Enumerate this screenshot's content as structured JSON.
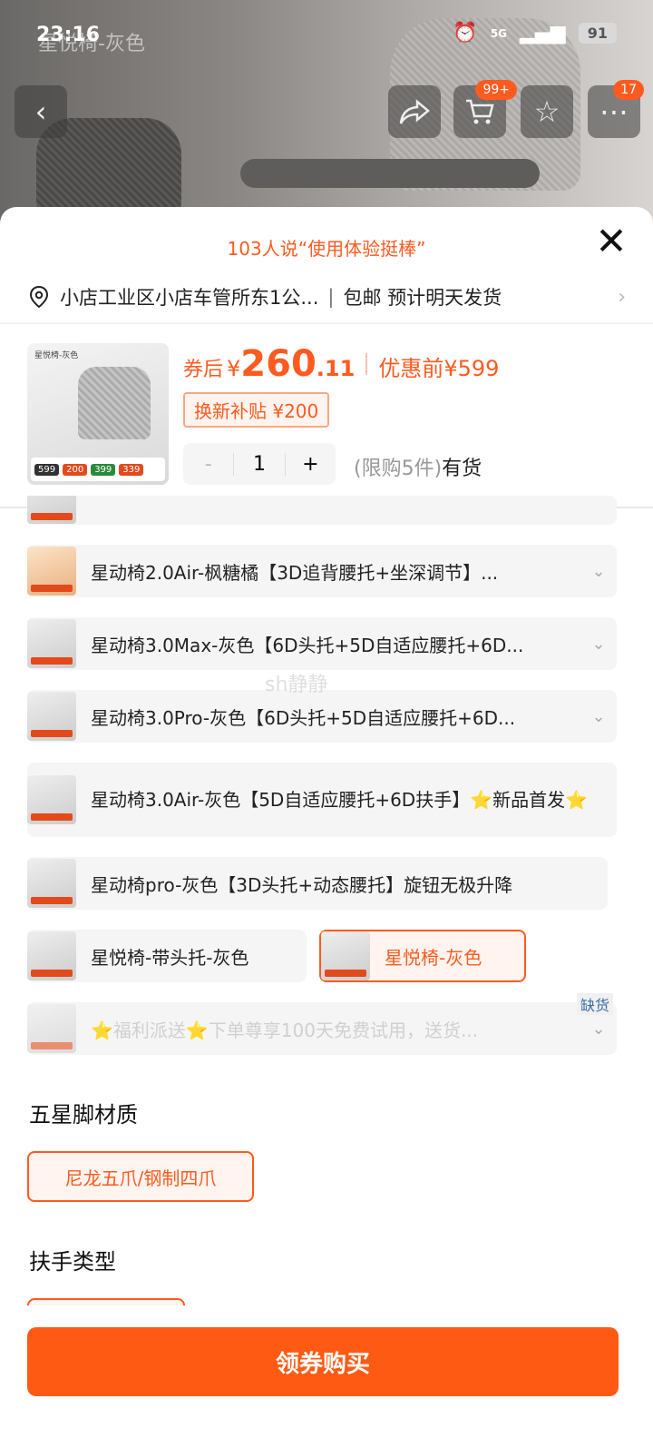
{
  "status": {
    "time": "23:16",
    "network": "5G",
    "battery": "91"
  },
  "page": {
    "title": "星悦椅-灰色"
  },
  "header": {
    "cart_badge": "99+",
    "menu_badge": "17"
  },
  "sheet": {
    "reviews_tip": "103人说“使用体验挺棒”",
    "address": "小店工业区小店车管所东1公...",
    "shipping": "包邮 预计明天发货",
    "price": {
      "coupon_label": "券后",
      "currency": "¥",
      "integer": "260",
      "decimal": ".11",
      "original_label": "优惠前",
      "original": "¥599"
    },
    "subsidy": "换新补贴 ¥200",
    "quantity": {
      "minus": "-",
      "value": "1",
      "plus": "+"
    },
    "limit": "(限购5件)",
    "stock": "有货",
    "thumb": {
      "label": "星悦椅-灰色",
      "tags": [
        "599",
        "200",
        "399",
        "339"
      ]
    }
  },
  "options": [
    {
      "text": "星动椅2.0Air-枫糖橘【3D追背腰托+坐深调节】...",
      "expandable": true
    },
    {
      "text": "星动椅3.0Max-灰色【6D头托+5D自适应腰托+6D...",
      "expandable": true
    },
    {
      "text": "星动椅3.0Pro-灰色【6D头托+5D自适应腰托+6D...",
      "expandable": true
    },
    {
      "text": "星动椅3.0Air-灰色【5D自适应腰托+6D扶手】⭐新品首发⭐",
      "expandable": false
    },
    {
      "text": "星动椅pro-灰色【3D头托+动态腰托】旋钮无极升降",
      "expandable": false
    },
    {
      "text": "星悦椅-带头托-灰色",
      "expandable": false
    },
    {
      "text": "星悦椅-灰色",
      "expandable": false
    },
    {
      "text": "⭐福利派送⭐下单尊享100天免费试用，送货...",
      "expandable": true,
      "badge": "缺货"
    }
  ],
  "watermark": "sh静静",
  "sections": {
    "base_material": {
      "title": "五星脚材质",
      "choice": "尼龙五爪/钢制四爪"
    },
    "armrest": {
      "title": "扶手类型"
    }
  },
  "buy_button": "领券购买",
  "colors": {
    "accent": "#ff5a1f",
    "button": "#ff5a14"
  }
}
